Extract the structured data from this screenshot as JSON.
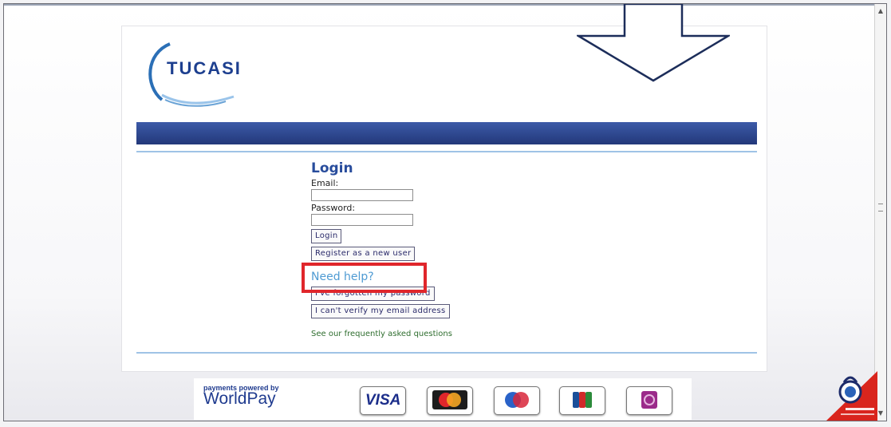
{
  "brand": {
    "logo_text": "TUCASI"
  },
  "login": {
    "heading": "Login",
    "email_label": "Email:",
    "password_label": "Password:",
    "login_button": "Login",
    "register_button": "Register as a new user"
  },
  "help": {
    "heading": "Need help?",
    "forgot_password_button": "I've forgotten my password",
    "verify_email_button": "I can't verify my email address",
    "faq_link": "See our frequently asked questions"
  },
  "footer": {
    "powered_by": "payments powered by",
    "worldpay": "WorldPay",
    "cards": [
      {
        "name": "visa",
        "text": "VISA"
      },
      {
        "name": "mastercard"
      },
      {
        "name": "maestro"
      },
      {
        "name": "jcb"
      },
      {
        "name": "solo"
      }
    ]
  },
  "badge": {
    "name": "comodo-secure-badge"
  },
  "colors": {
    "brand_blue": "#1d3f8f",
    "banner": "#2b428a",
    "highlight": "#e0262b",
    "help_blue": "#4f9bd3",
    "link_green": "#2f6e2f"
  }
}
